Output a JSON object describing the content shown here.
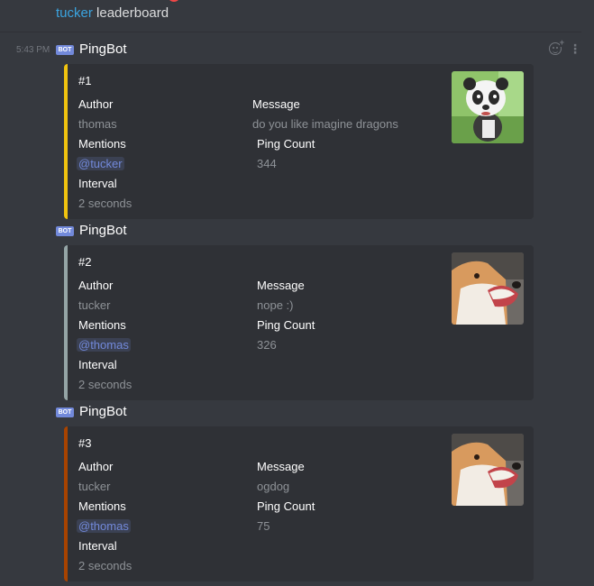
{
  "header": {
    "mention_name": "tucker",
    "rest": "leaderboard"
  },
  "messages": [
    {
      "timestamp": "5:43 PM",
      "bot_tag": "BOT",
      "author": "PingBot",
      "embed": {
        "color": "#f1c40f",
        "rank": "#1",
        "author_label": "Author",
        "author_value": "thomas",
        "message_label": "Message",
        "message_value": "do you like imagine dragons",
        "mentions_label": "Mentions",
        "mentions_value": "@tucker",
        "ping_label": "Ping Count",
        "ping_value": "344",
        "interval_label": "Interval",
        "interval_value": "2 seconds",
        "thumbnail": "panda-avatar"
      }
    },
    {
      "timestamp": "",
      "bot_tag": "BOT",
      "author": "PingBot",
      "embed": {
        "color": "#95a5a6",
        "rank": "#2",
        "author_label": "Author",
        "author_value": "tucker",
        "message_label": "Message",
        "message_value": "nope :)",
        "mentions_label": "Mentions",
        "mentions_value": "@thomas",
        "ping_label": "Ping Count",
        "ping_value": "326",
        "interval_label": "Interval",
        "interval_value": "2 seconds",
        "thumbnail": "dog-avatar"
      }
    },
    {
      "timestamp": "",
      "bot_tag": "BOT",
      "author": "PingBot",
      "embed": {
        "color": "#a84300",
        "rank": "#3",
        "author_label": "Author",
        "author_value": "tucker",
        "message_label": "Message",
        "message_value": "ogdog",
        "mentions_label": "Mentions",
        "mentions_value": "@thomas",
        "ping_label": "Ping Count",
        "ping_value": "75",
        "interval_label": "Interval",
        "interval_value": "2 seconds",
        "thumbnail": "dog-avatar"
      }
    }
  ],
  "icons": {
    "add_reaction": "add-reaction-icon",
    "more": "more-options-icon"
  },
  "colors": {
    "background": "#36393f",
    "embed_background": "#2f3136",
    "mention": "#7289da",
    "bot_tag": "#7289da"
  }
}
